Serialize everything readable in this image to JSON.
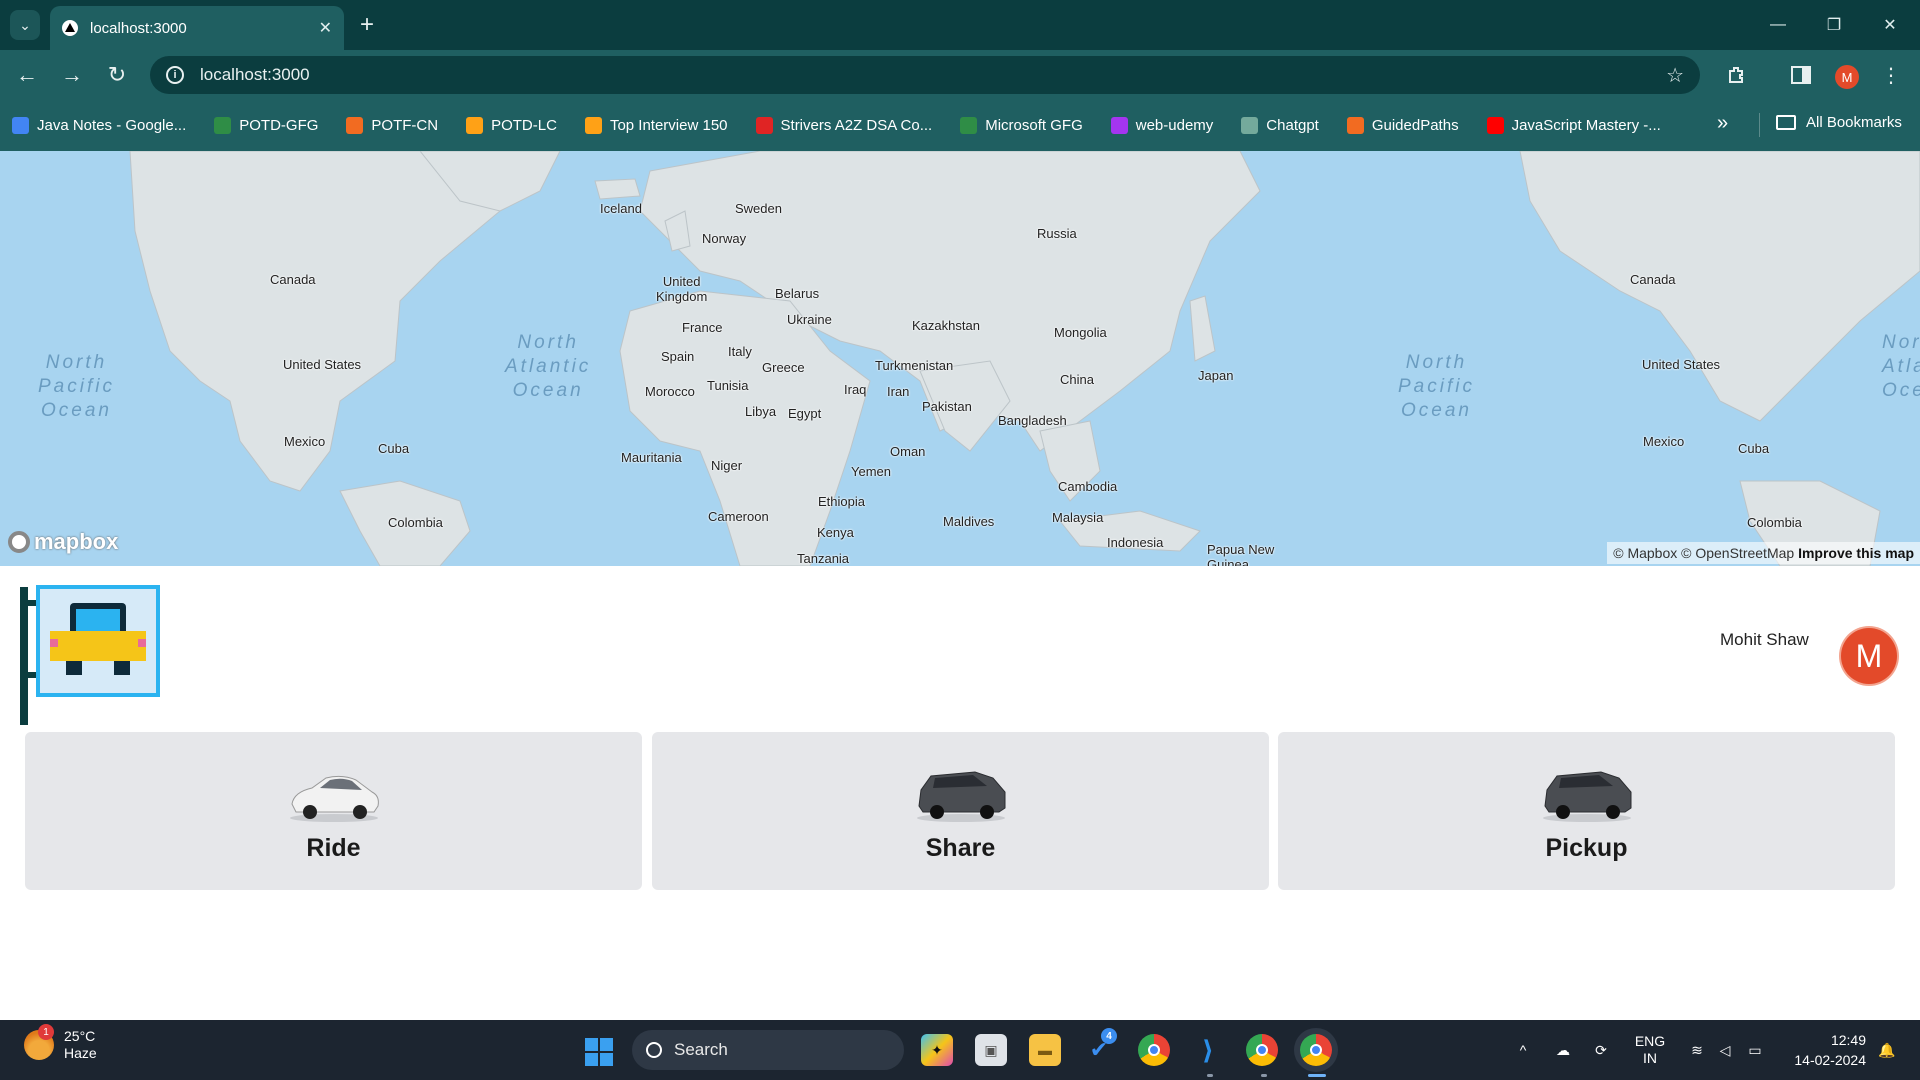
{
  "browser": {
    "tab_title": "localhost:3000",
    "url": "localhost:3000",
    "bookmarks": [
      {
        "label": "Java Notes - Google...",
        "color": "#4285f4"
      },
      {
        "label": "POTD-GFG",
        "color": "#2f8d46"
      },
      {
        "label": "POTF-CN",
        "color": "#f26b21"
      },
      {
        "label": "POTD-LC",
        "color": "#ffa116"
      },
      {
        "label": "Top Interview 150",
        "color": "#ffa116"
      },
      {
        "label": "Strivers A2Z DSA Co...",
        "color": "#e02424"
      },
      {
        "label": "Microsoft GFG",
        "color": "#2f8d46"
      },
      {
        "label": "web-udemy",
        "color": "#a435f0"
      },
      {
        "label": "Chatgpt",
        "color": "#74aa9c"
      },
      {
        "label": "GuidedPaths",
        "color": "#f26b21"
      },
      {
        "label": "JavaScript Mastery -...",
        "color": "#ff0000"
      }
    ],
    "all_bookmarks": "All Bookmarks",
    "profile_initial": "M"
  },
  "map": {
    "labels": {
      "iceland": "Iceland",
      "sweden": "Sweden",
      "norway": "Norway",
      "russia": "Russia",
      "canada_left": "Canada",
      "canada_right": "Canada",
      "uk": "United\nKingdom",
      "belarus": "Belarus",
      "ukraine": "Ukraine",
      "france": "France",
      "kazakhstan": "Kazakhstan",
      "mongolia": "Mongolia",
      "spain": "Spain",
      "italy": "Italy",
      "us_left": "United States",
      "us_right": "United States",
      "turkmenistan": "Turkmenistan",
      "greece": "Greece",
      "tunisia": "Tunisia",
      "iraq": "Iraq",
      "iran": "Iran",
      "china": "China",
      "japan": "Japan",
      "morocco": "Morocco",
      "pakistan": "Pakistan",
      "libya": "Libya",
      "egypt": "Egypt",
      "mexico_left": "Mexico",
      "mexico_right": "Mexico",
      "cuba_left": "Cuba",
      "cuba_right": "Cuba",
      "bangladesh": "Bangladesh",
      "oman": "Oman",
      "mauritania": "Mauritania",
      "niger": "Niger",
      "yemen": "Yemen",
      "cambodia": "Cambodia",
      "ethiopia": "Ethiopia",
      "maldives": "Maldives",
      "malaysia": "Malaysia",
      "cameroon": "Cameroon",
      "colombia_left": "Colombia",
      "colombia_right": "Colombia",
      "kenya": "Kenya",
      "indonesia": "Indonesia",
      "png": "Papua New\nGuinea",
      "tanzania": "Tanzania"
    },
    "oceans": {
      "north_pacific_left": "North\nPacific\nOcean",
      "north_atlantic": "North\nAtlantic\nOcean",
      "north_pacific_right": "North\nPacific\nOcean",
      "north_atlantic_right": "Nor\nAtla\nOce"
    },
    "logo": "mapbox",
    "attribution": "© Mapbox © OpenStreetMap",
    "improve": "Improve this map"
  },
  "app": {
    "user_name": "Mohit Shaw",
    "avatar_initial": "M",
    "services": [
      {
        "label": "Ride",
        "car_color": "#f2f2f2"
      },
      {
        "label": "Share",
        "car_color": "#4a4d52"
      },
      {
        "label": "Pickup",
        "car_color": "#4a4d52"
      }
    ]
  },
  "taskbar": {
    "weather_temp": "25°C",
    "weather_desc": "Haze",
    "weather_badge": "1",
    "search_placeholder": "Search",
    "todo_badge": "4",
    "lang_line1": "ENG",
    "lang_line2": "IN",
    "time": "12:49",
    "date": "14-02-2024"
  }
}
